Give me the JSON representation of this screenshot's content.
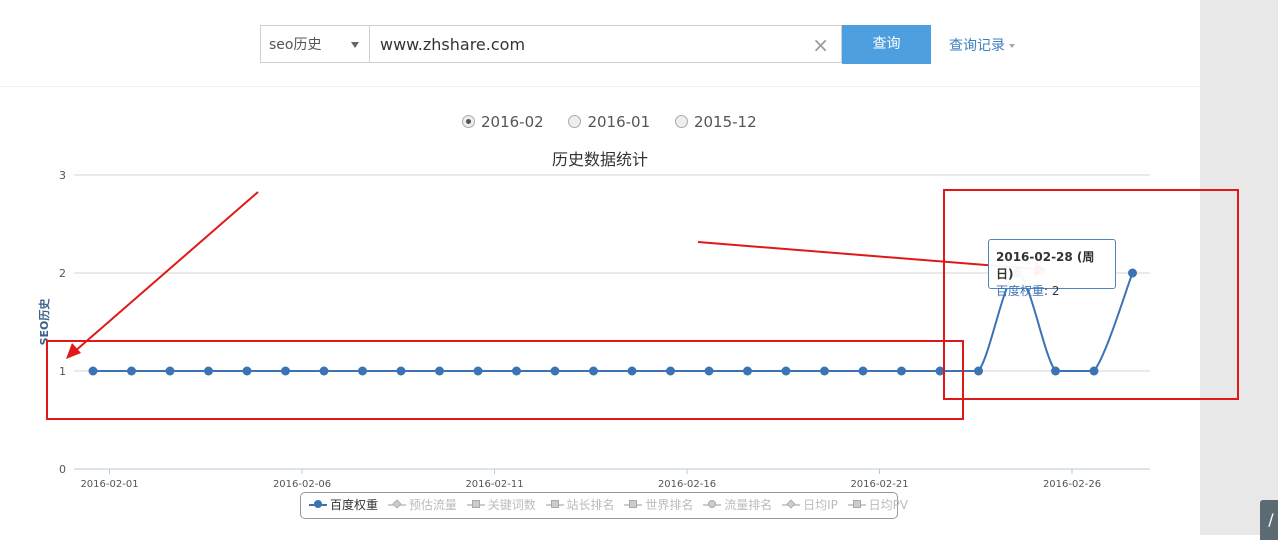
{
  "search": {
    "type_select": "seo历史",
    "query": "www.zhshare.com",
    "clear_symbol": "×",
    "button": "查询",
    "history_link": "查询记录"
  },
  "months": [
    {
      "label": "2016-02",
      "checked": true
    },
    {
      "label": "2016-01",
      "checked": false
    },
    {
      "label": "2015-12",
      "checked": false
    }
  ],
  "tooltip": {
    "title": "2016-02-28 (周日)",
    "series_name": "百度权重",
    "value": "2"
  },
  "colors": {
    "series": "#3c73b5",
    "annotation": "#e01818"
  },
  "chart_data": {
    "type": "line",
    "title": "历史数据统计",
    "ylabel": "SEO历史",
    "xlabel": "",
    "ylim": [
      0,
      3
    ],
    "yticks": [
      "0",
      "1",
      "2",
      "3"
    ],
    "x": [
      "2016-02-01",
      "2016-02-02",
      "2016-02-03",
      "2016-02-04",
      "2016-02-05",
      "2016-02-06",
      "2016-02-07",
      "2016-02-08",
      "2016-02-09",
      "2016-02-10",
      "2016-02-11",
      "2016-02-12",
      "2016-02-13",
      "2016-02-14",
      "2016-02-15",
      "2016-02-16",
      "2016-02-17",
      "2016-02-18",
      "2016-02-19",
      "2016-02-20",
      "2016-02-21",
      "2016-02-22",
      "2016-02-23",
      "2016-02-24",
      "2016-02-25",
      "2016-02-26",
      "2016-02-27",
      "2016-02-28"
    ],
    "xtick_labels": [
      "2016-02-01",
      "2016-02-06",
      "2016-02-11",
      "2016-02-16",
      "2016-02-21",
      "2016-02-26"
    ],
    "series": [
      {
        "name": "百度权重",
        "values": [
          1,
          1,
          1,
          1,
          1,
          1,
          1,
          1,
          1,
          1,
          1,
          1,
          1,
          1,
          1,
          1,
          1,
          1,
          1,
          1,
          1,
          1,
          1,
          1,
          2,
          1,
          1,
          2
        ]
      }
    ],
    "legend": [
      "百度权重",
      "预估流量",
      "关键词数",
      "站长排名",
      "世界排名",
      "流量排名",
      "日均IP",
      "日均PV"
    ],
    "legend_placement": "bottom-center",
    "grid": true
  }
}
